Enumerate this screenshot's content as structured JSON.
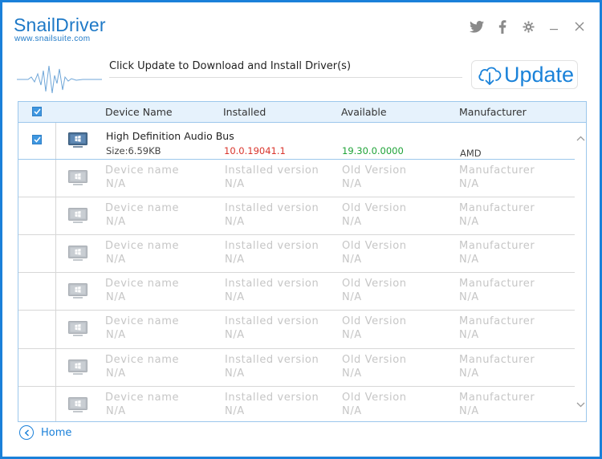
{
  "app": {
    "logo_title": "SnailDriver",
    "logo_url_text": "www.snailsuite.com",
    "accent_color": "#1a80d9"
  },
  "window_controls": {
    "twitter_icon": "twitter-icon",
    "facebook_icon": "facebook-icon",
    "settings_icon": "gear-icon",
    "minimize_label": "_",
    "close_label": "✕"
  },
  "header": {
    "instruction": "Click Update to Download and Install Driver(s)",
    "update_label": "Update"
  },
  "table": {
    "columns": {
      "device_name": "Device Name",
      "installed": "Installed",
      "available": "Available",
      "manufacturer": "Manufacturer"
    },
    "driver": {
      "name": "High Definition Audio Bus",
      "size": "Size:6.59KB",
      "installed": "10.0.19041.1",
      "available": "19.30.0.0000",
      "manufacturer": "AMD",
      "checked": true
    },
    "placeholders": [
      {
        "name": "Device name",
        "name_val": "N/A",
        "installed": "Installed version",
        "installed_val": "N/A",
        "old": "Old Version",
        "old_val": "N/A",
        "mfr": "Manufacturer",
        "mfr_val": "N/A"
      },
      {
        "name": "Device name",
        "name_val": "N/A",
        "installed": "Installed version",
        "installed_val": "N/A",
        "old": "Old Version",
        "old_val": "N/A",
        "mfr": "Manufacturer",
        "mfr_val": "N/A"
      },
      {
        "name": "Device name",
        "name_val": "N/A",
        "installed": "Installed version",
        "installed_val": "N/A",
        "old": "Old Version",
        "old_val": "N/A",
        "mfr": "Manufacturer",
        "mfr_val": "N/A"
      },
      {
        "name": "Device name",
        "name_val": "N/A",
        "installed": "Installed version",
        "installed_val": "N/A",
        "old": "Old Version",
        "old_val": "N/A",
        "mfr": "Manufacturer",
        "mfr_val": "N/A"
      },
      {
        "name": "Device name",
        "name_val": "N/A",
        "installed": "Installed version",
        "installed_val": "N/A",
        "old": "Old Version",
        "old_val": "N/A",
        "mfr": "Manufacturer",
        "mfr_val": "N/A"
      },
      {
        "name": "Device name",
        "name_val": "N/A",
        "installed": "Installed version",
        "installed_val": "N/A",
        "old": "Old Version",
        "old_val": "N/A",
        "mfr": "Manufacturer",
        "mfr_val": "N/A"
      },
      {
        "name": "Device name",
        "name_val": "N/A",
        "installed": "Installed version",
        "installed_val": "N/A",
        "old": "Old Version",
        "old_val": "N/A",
        "mfr": "Manufacturer",
        "mfr_val": "N/A"
      }
    ]
  },
  "footer": {
    "home_label": "Home"
  }
}
